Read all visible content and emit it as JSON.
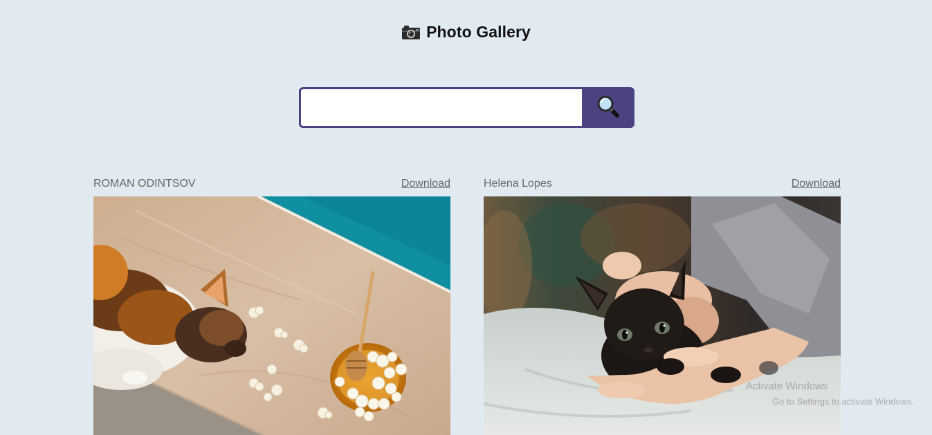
{
  "header": {
    "icon": "camera-icon",
    "title": "Photo Gallery"
  },
  "search": {
    "value": "",
    "placeholder": "",
    "button_icon": "magnifying-glass-icon",
    "accent_color": "#4b4381"
  },
  "photos": [
    {
      "author": "ROMAN ODINTSOV",
      "download_label": "Download",
      "subject": "calico cat eating popcorn next to honey bowl"
    },
    {
      "author": "Helena Lopes",
      "download_label": "Download",
      "subject": "black kitten held in hands"
    }
  ],
  "watermark": {
    "line1": "Activate Windows",
    "line2": "Go to Settings to activate Windows."
  }
}
